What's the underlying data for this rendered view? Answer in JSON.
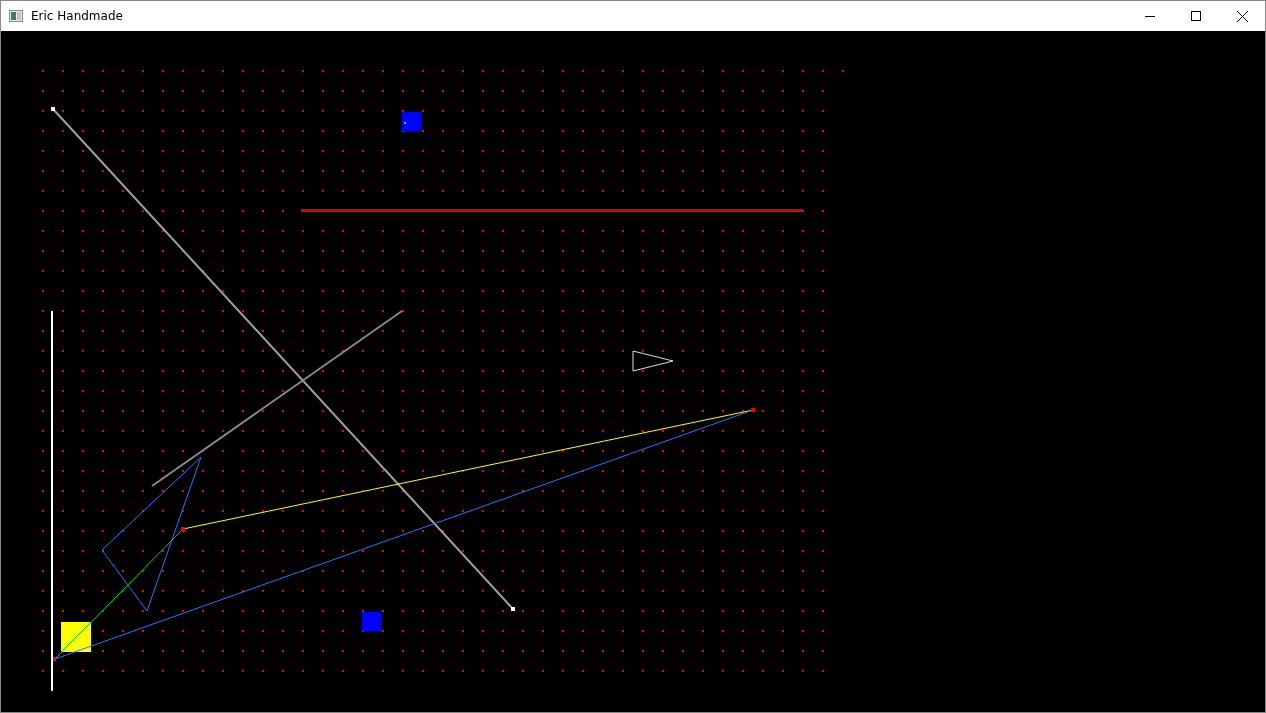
{
  "window": {
    "title": "Eric Handmade"
  }
}
